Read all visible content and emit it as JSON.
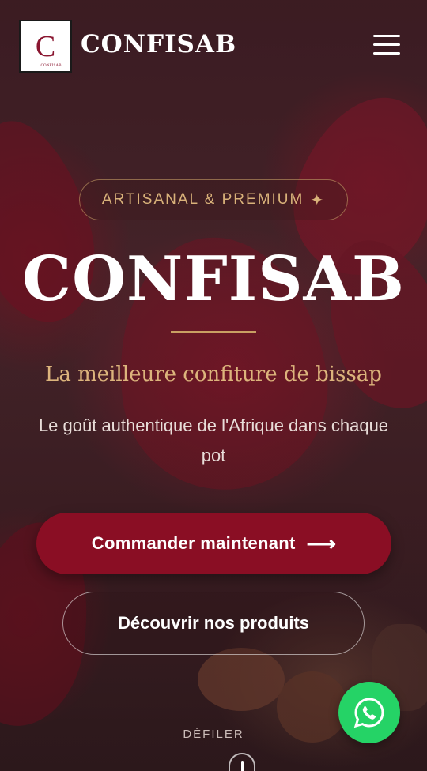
{
  "header": {
    "logo_letter": "C",
    "logo_subtext": "CONFISAB",
    "brand": "CONFISAB",
    "menu_icon": "hamburger-menu-icon"
  },
  "hero": {
    "badge_label": "ARTISANAL & PREMIUM",
    "badge_icon": "sparkle-icon",
    "title": "CONFISAB",
    "tagline": "La meilleure confiture de bissap",
    "description": "Le goût authentique de l'Afrique dans chaque pot",
    "primary_button": "Commander maintenant",
    "primary_button_icon": "arrow-right-icon",
    "secondary_button": "Découvrir nos produits",
    "scroll_label": "DÉFILER"
  },
  "floating": {
    "whatsapp_icon": "whatsapp-icon"
  },
  "colors": {
    "accent": "#8a0e24",
    "gold": "#d9b27a",
    "whatsapp": "#25d366"
  }
}
